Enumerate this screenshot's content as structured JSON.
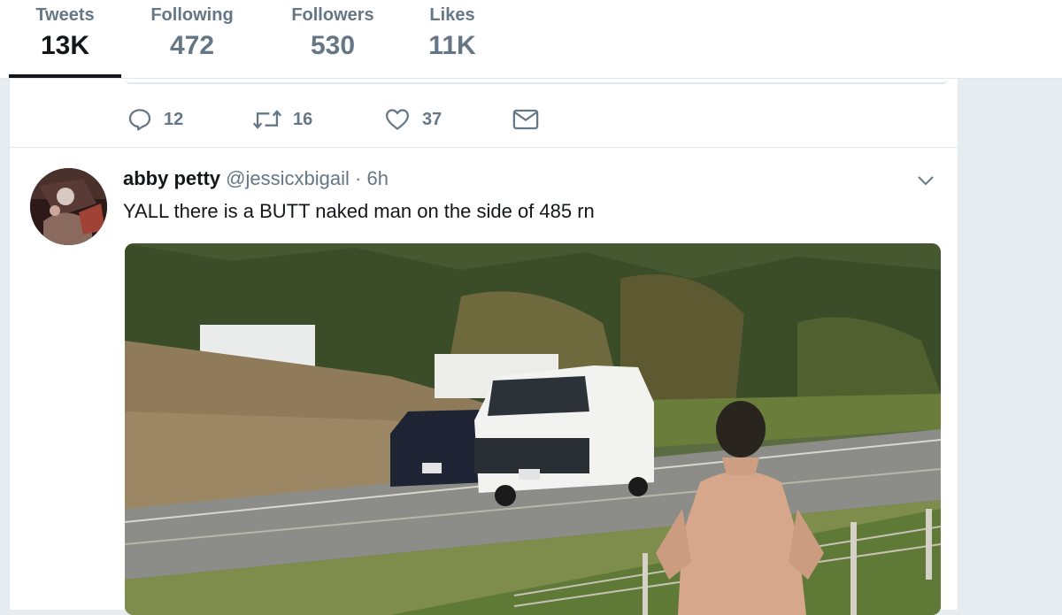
{
  "profile_nav": {
    "items": [
      {
        "label": "Tweets",
        "value": "13K",
        "active": true
      },
      {
        "label": "Following",
        "value": "472"
      },
      {
        "label": "Followers",
        "value": "530"
      },
      {
        "label": "Likes",
        "value": "11K"
      }
    ]
  },
  "prev_tweet": {
    "actions": {
      "reply_count": "12",
      "retweet_count": "16",
      "like_count": "37"
    }
  },
  "tweet": {
    "author_name": "abby petty",
    "handle": "@jessicxbigail",
    "separator": "·",
    "time": "6h",
    "text": "YALL there is a BUTT naked man on the side of 485 rn"
  },
  "colors": {
    "text_primary": "#14171a",
    "text_secondary": "#657786",
    "border": "#e1e8ed",
    "background": "#e6ecf0"
  },
  "icons": [
    "reply-icon",
    "retweet-icon",
    "like-icon",
    "direct-message-icon",
    "chevron-down-icon"
  ]
}
